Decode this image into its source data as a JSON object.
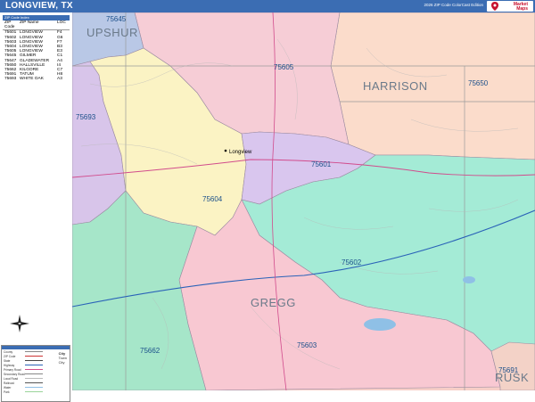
{
  "title": "LONGVIEW, TX",
  "edition": "2026 ZIP Code ColorCast Edition",
  "brand": {
    "line1": "Market",
    "line2": "Maps"
  },
  "zip_table": {
    "heading": "ZIP Code Index",
    "col_zip": "ZIP Code",
    "col_name": "ZIP Name",
    "col_loc": "LOC",
    "rows": [
      {
        "zip": "75601",
        "name": "LONGVIEW",
        "loc": "F4"
      },
      {
        "zip": "75602",
        "name": "LONGVIEW",
        "loc": "G6"
      },
      {
        "zip": "75603",
        "name": "LONGVIEW",
        "loc": "F7"
      },
      {
        "zip": "75604",
        "name": "LONGVIEW",
        "loc": "B3"
      },
      {
        "zip": "75605",
        "name": "LONGVIEW",
        "loc": "E3"
      },
      {
        "zip": "75645",
        "name": "GILMER",
        "loc": "C1"
      },
      {
        "zip": "75647",
        "name": "GLADEWATER",
        "loc": "A4"
      },
      {
        "zip": "75650",
        "name": "HALLSVILLE",
        "loc": "I4"
      },
      {
        "zip": "75662",
        "name": "KILGORE",
        "loc": "C7"
      },
      {
        "zip": "75691",
        "name": "TATUM",
        "loc": "H8"
      },
      {
        "zip": "75693",
        "name": "WHITE OAK",
        "loc": "A3"
      }
    ]
  },
  "map": {
    "zip_labels": [
      "75645",
      "75605",
      "75650",
      "75693",
      "75601",
      "75604",
      "75602",
      "75603",
      "75662",
      "75691"
    ],
    "county_labels": [
      "UPSHUR",
      "HARRISON",
      "GREGG",
      "RUSK"
    ],
    "city_label": "Longview",
    "zone_colors": {
      "z75645": "#b9c8e6",
      "z75605": "#f6cdd6",
      "z75650": "#fbdccb",
      "z75693": "#d8c5ea",
      "z75601": "#d9c6ee",
      "z75604": "#fbf3c4",
      "z75602": "#a4ebd6",
      "z75603": "#f8c8d2",
      "z75662": "#a6e6c9",
      "z75691": "#f3d2c7",
      "ne": "#f7cfc8"
    }
  },
  "key": {
    "rows": [
      "County",
      "ZIP Code",
      "State",
      "Highway",
      "Primary Road",
      "Secondary Road",
      "Local Road",
      "Railroad",
      "Water",
      "Park"
    ],
    "cities": [
      "City",
      "Town",
      "City"
    ]
  }
}
